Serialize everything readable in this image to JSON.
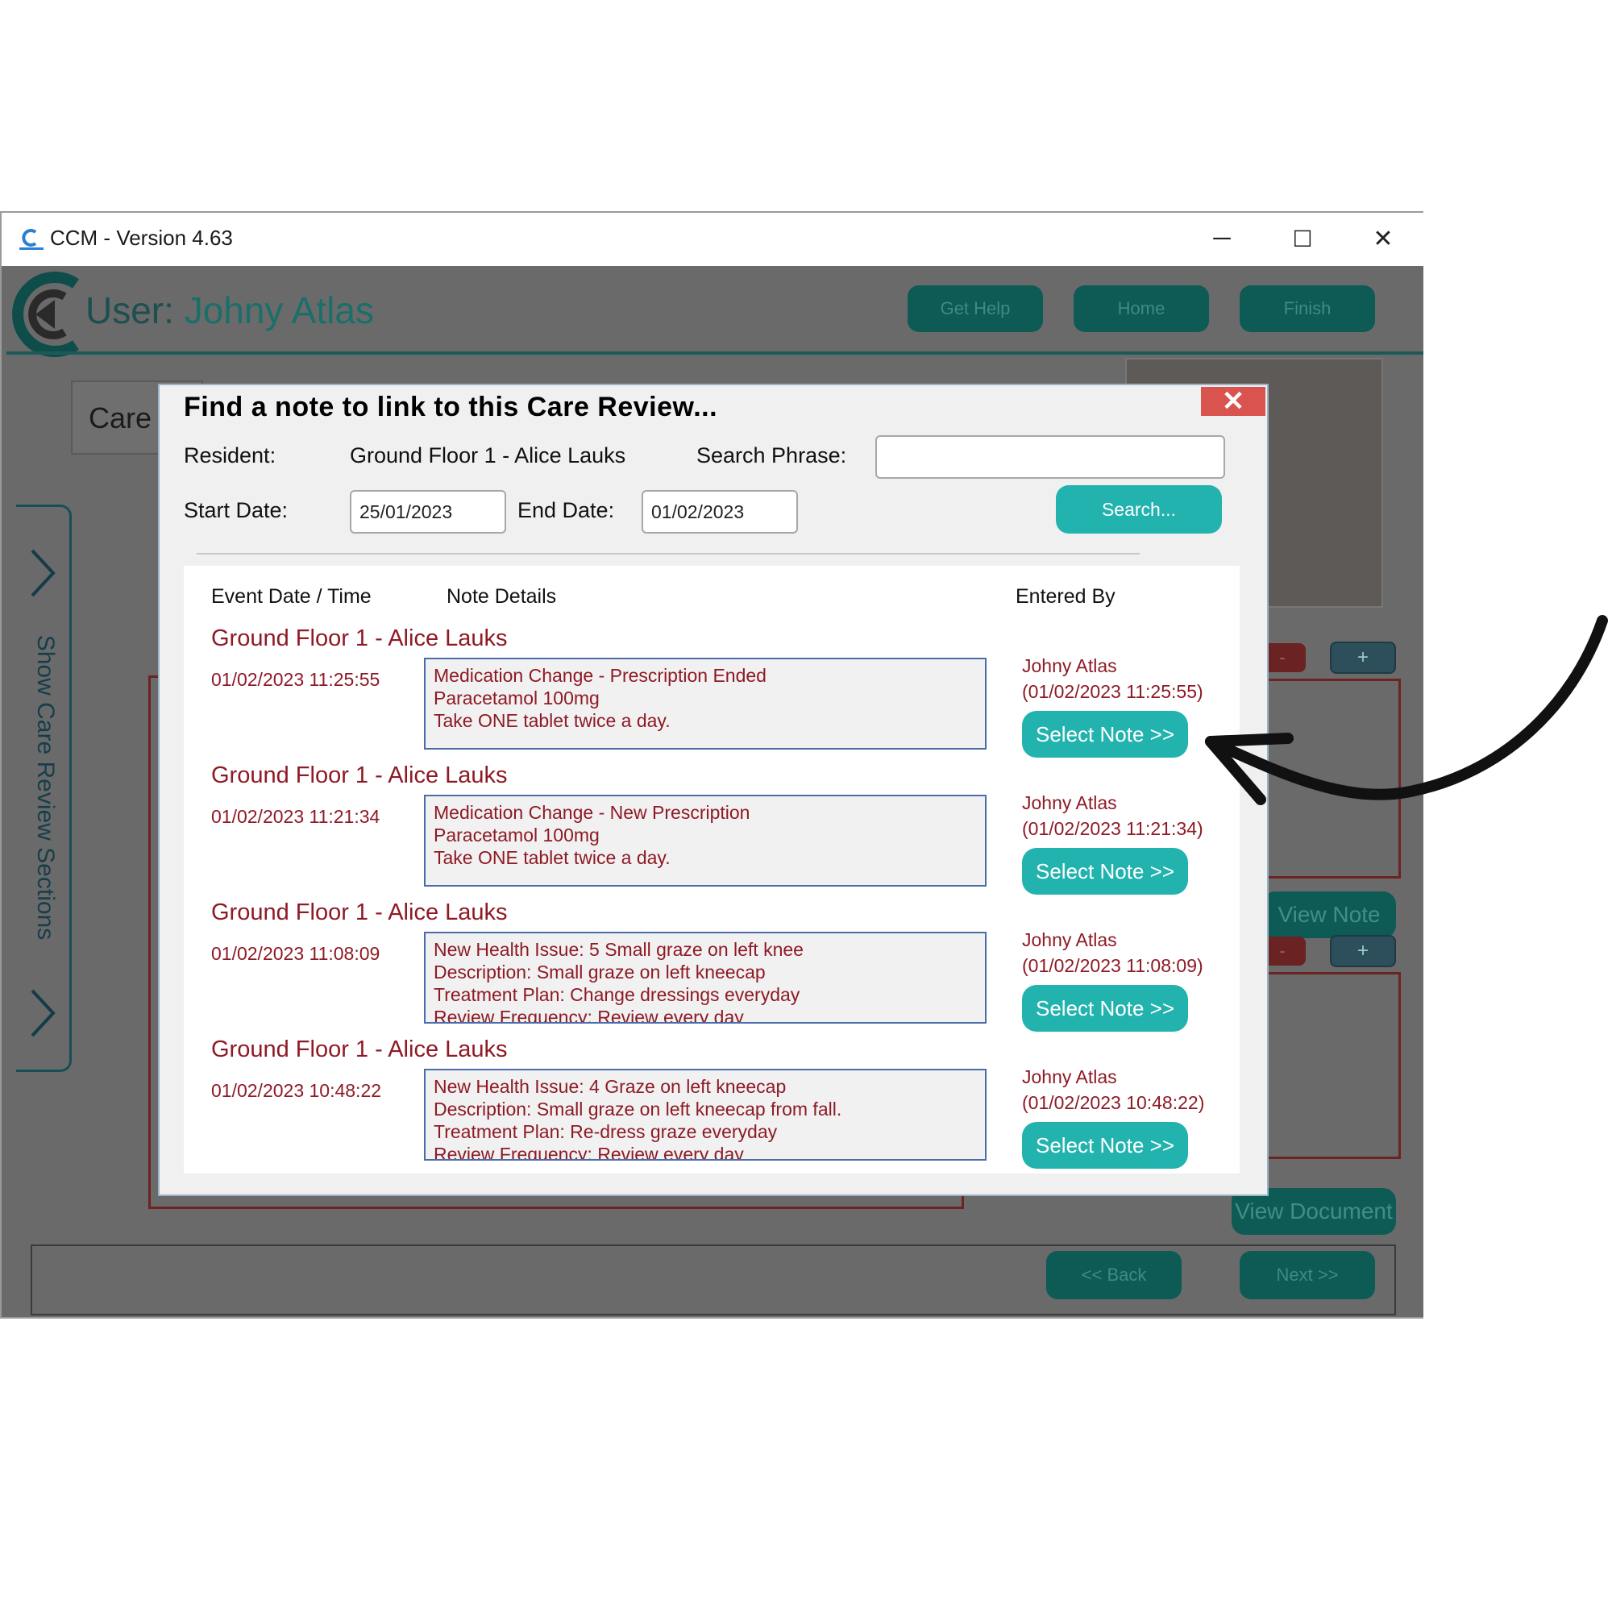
{
  "window": {
    "title": "CCM - Version 4.63",
    "controls": {
      "minimize": "─",
      "maximize": "☐",
      "close": "✕"
    }
  },
  "app": {
    "user_prefix": "User: ",
    "user_name": "Johny Atlas",
    "top_buttons": {
      "help": "Get Help",
      "home": "Home",
      "finish": "Finish"
    },
    "care_label": "Care",
    "side_panel_label": "Show Care Review Sections",
    "mini_buttons": {
      "minus": "-",
      "plus": "+"
    },
    "view_note": "View Note",
    "view_document": "View Document",
    "nav": {
      "back": "<< Back",
      "next": "Next >>"
    },
    "colors": {
      "accent": "#22b3ae",
      "dim_accent": "#0e5a55",
      "note_text": "#8e1a25"
    }
  },
  "modal": {
    "title": "Find a note to link to this Care Review...",
    "close_icon": "close-icon",
    "resident_label": "Resident:",
    "resident_value": "Ground Floor 1 - Alice Lauks",
    "search_phrase_label": "Search Phrase:",
    "search_phrase_value": "",
    "start_date_label": "Start Date:",
    "start_date_value": "25/01/2023",
    "end_date_label": "End Date:",
    "end_date_value": "01/02/2023",
    "search_button": "Search...",
    "columns": {
      "event": "Event Date / Time",
      "details": "Note Details",
      "entered_by": "Entered By"
    },
    "notes": [
      {
        "resident": "Ground Floor 1 - Alice Lauks",
        "event_time": "01/02/2023 11:25:55",
        "lines": [
          "Medication Change - Prescription Ended",
          "Paracetamol 100mg",
          "Take ONE tablet twice a day."
        ],
        "entered_by": "Johny Atlas",
        "entered_at": "(01/02/2023 11:25:55)",
        "select_label": "Select Note >>"
      },
      {
        "resident": "Ground Floor 1 - Alice Lauks",
        "event_time": "01/02/2023 11:21:34",
        "lines": [
          "Medication Change - New Prescription",
          "Paracetamol 100mg",
          "Take ONE tablet twice a day."
        ],
        "entered_by": "Johny Atlas",
        "entered_at": "(01/02/2023 11:21:34)",
        "select_label": "Select Note >>"
      },
      {
        "resident": "Ground Floor 1 - Alice Lauks",
        "event_time": "01/02/2023 11:08:09",
        "lines": [
          "New Health Issue: 5 Small graze on left knee",
          "Description: Small graze on left kneecap",
          "Treatment Plan: Change dressings everyday",
          "Review Frequency: Review every day"
        ],
        "entered_by": "Johny Atlas",
        "entered_at": "(01/02/2023 11:08:09)",
        "select_label": "Select Note >>"
      },
      {
        "resident": "Ground Floor 1 - Alice Lauks",
        "event_time": "01/02/2023 10:48:22",
        "lines": [
          "New Health Issue: 4 Graze on left kneecap",
          "Description: Small graze on left kneecap from fall.",
          "Treatment Plan: Re-dress graze everyday",
          "Review Frequency: Review every day"
        ],
        "entered_by": "Johny Atlas",
        "entered_at": "(01/02/2023 10:48:22)",
        "select_label": "Select Note >>"
      }
    ]
  },
  "annotation": {
    "arrow_icon": "curved-arrow-icon"
  }
}
